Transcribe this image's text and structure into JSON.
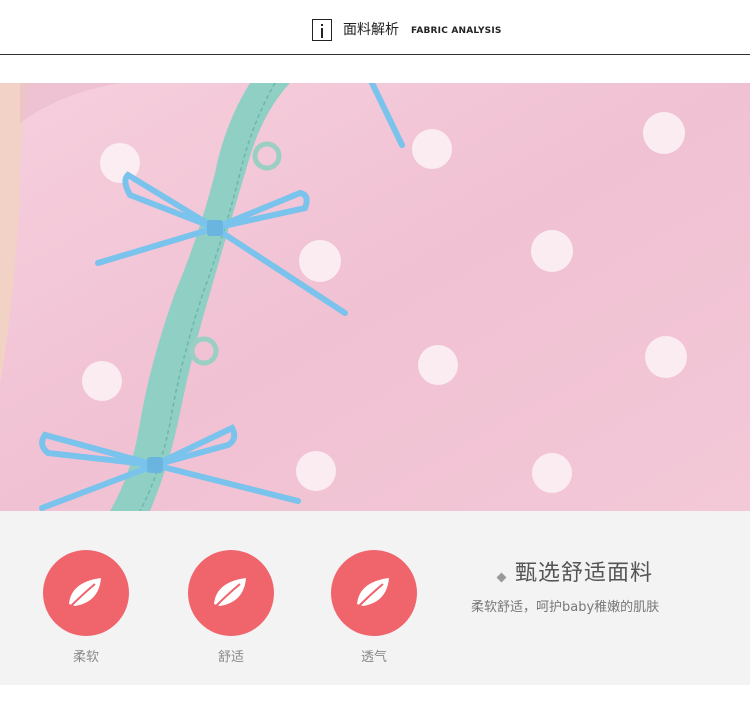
{
  "header": {
    "title_cn": "面料解析",
    "title_en": "FABRIC ANALYSIS",
    "icon": "info-icon"
  },
  "photo": {
    "description_icon": "fabric-photo"
  },
  "features": [
    {
      "label": "柔软",
      "icon": "leaf-icon"
    },
    {
      "label": "舒适",
      "icon": "leaf-icon"
    },
    {
      "label": "透气",
      "icon": "leaf-icon"
    }
  ],
  "headline": "甄选舒适面料",
  "subline": "柔软舒适，呵护baby稚嫩的肌肤",
  "colors": {
    "fabric_pink": "#f1c4d6",
    "trim_mint": "#8fcfc4",
    "ribbon_blue": "#79c3ec",
    "accent_red": "#f0646c",
    "panel_gray": "#f4f3f3"
  }
}
